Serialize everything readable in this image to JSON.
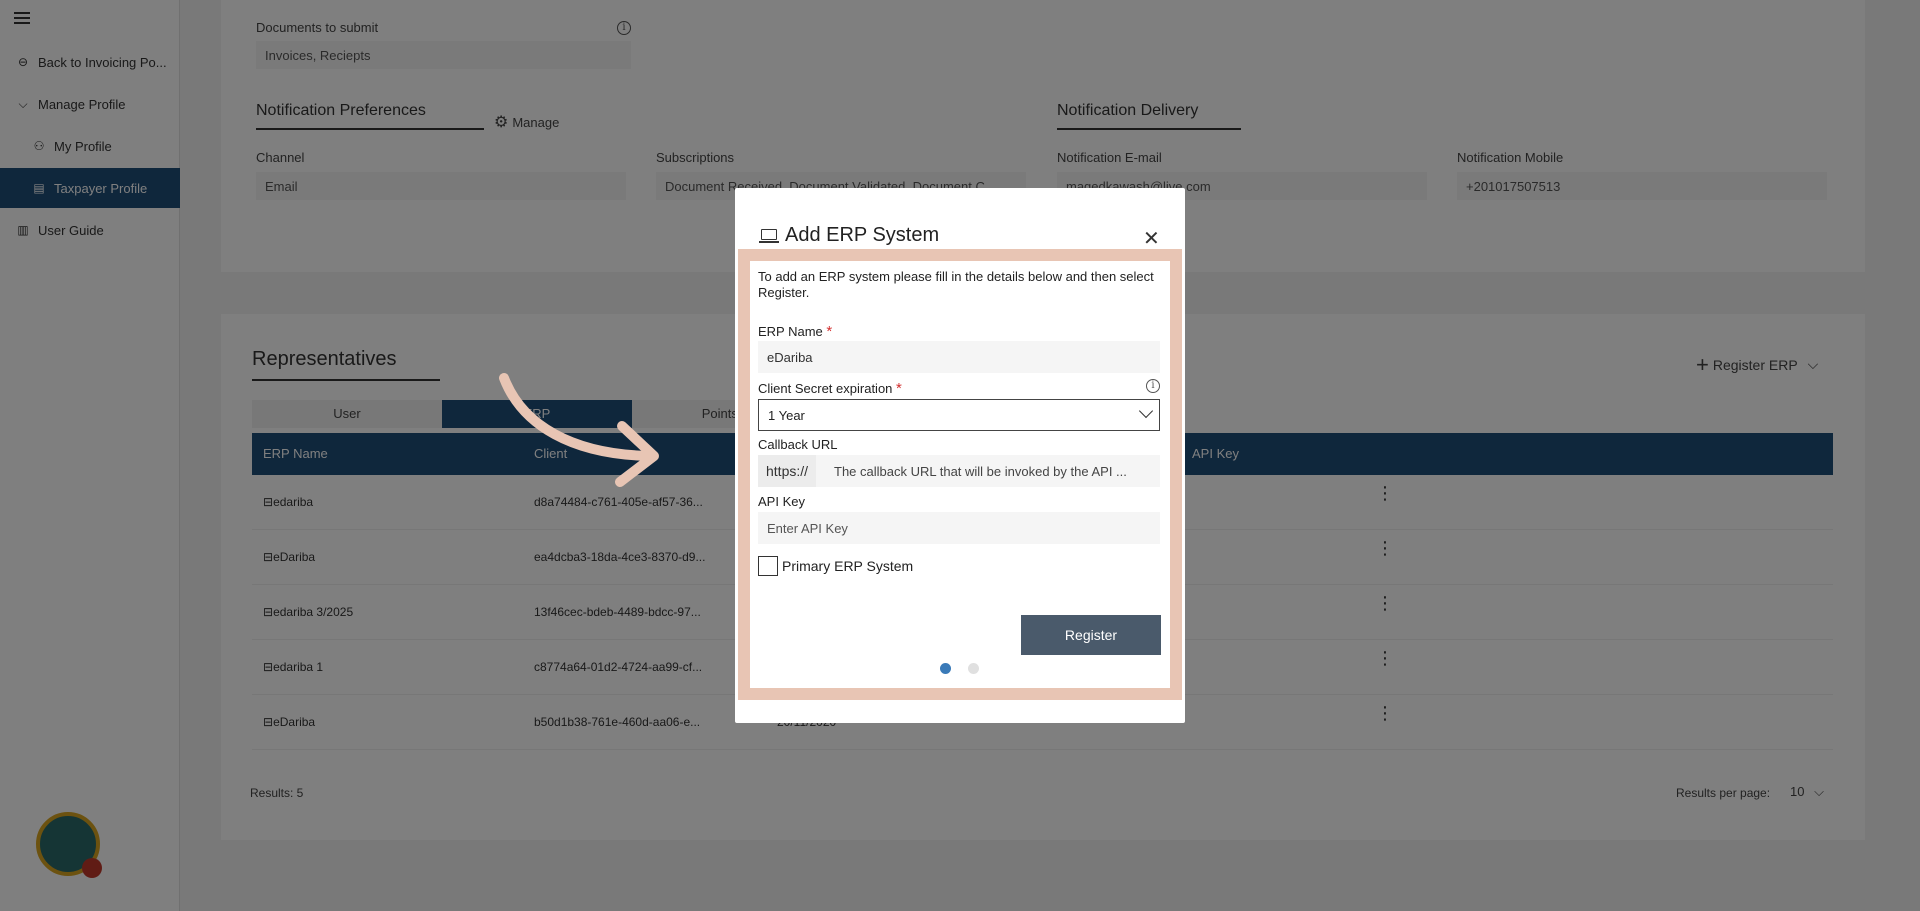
{
  "sidebar": {
    "items": [
      {
        "label": "Back to Invoicing Po..."
      },
      {
        "label": "Manage Profile"
      },
      {
        "label": "My Profile"
      },
      {
        "label": "Taxpayer Profile"
      },
      {
        "label": "User Guide"
      }
    ]
  },
  "profile": {
    "documents_label": "Documents to submit",
    "documents_value": "Invoices, Reciepts",
    "notif_pref_title": "Notification Preferences",
    "manage_label": "Manage",
    "notif_delivery_title": "Notification Delivery",
    "channel_label": "Channel",
    "channel_value": "Email",
    "subscriptions_label": "Subscriptions",
    "subscriptions_value": "Document Received, Document Validated, Document C...",
    "email_label": "Notification E-mail",
    "email_value": "magedkawash@live.com",
    "mobile_label": "Notification Mobile",
    "mobile_value": "+201017507513"
  },
  "representatives": {
    "title": "Representatives",
    "register_erp": "Register ERP",
    "tabs": [
      "User",
      "ERP",
      "Points of"
    ],
    "columns": [
      "ERP Name",
      "Client",
      "API Key"
    ],
    "rows": [
      {
        "name": "edariba",
        "client": "d8a74484-c761-405e-af57-36..."
      },
      {
        "name": "eDariba",
        "client": "ea4dcba3-18da-4ce3-8370-d9..."
      },
      {
        "name": "edariba 3/2025",
        "client": "13f46cec-bdeb-4489-bdcc-97..."
      },
      {
        "name": "edariba 1",
        "client": "c8774a64-01d2-4724-aa99-cf..."
      },
      {
        "name": "eDariba",
        "client": "b50d1b38-761e-460d-aa06-e...",
        "date": "20/11/2020"
      }
    ],
    "results": "Results: 5",
    "per_page_label": "Results per page:",
    "per_page_value": "10"
  },
  "modal": {
    "title": "Add ERP System",
    "intro": "To add an ERP system please fill in the details below and then select Register.",
    "erp_name_label": "ERP Name",
    "erp_name_value": "eDariba",
    "secret_label": "Client Secret expiration",
    "secret_value": "1 Year",
    "callback_label": "Callback URL",
    "callback_prefix": "https://",
    "callback_placeholder": "The callback URL that will be invoked by the API ...",
    "api_key_label": "API Key",
    "api_key_placeholder": "Enter API Key",
    "primary_label": "Primary ERP System",
    "register_label": "Register",
    "required_mark": "*"
  },
  "colors": {
    "primary": "#1f4e79",
    "highlight": "#e8c5b4",
    "button": "#4a5a6b"
  }
}
